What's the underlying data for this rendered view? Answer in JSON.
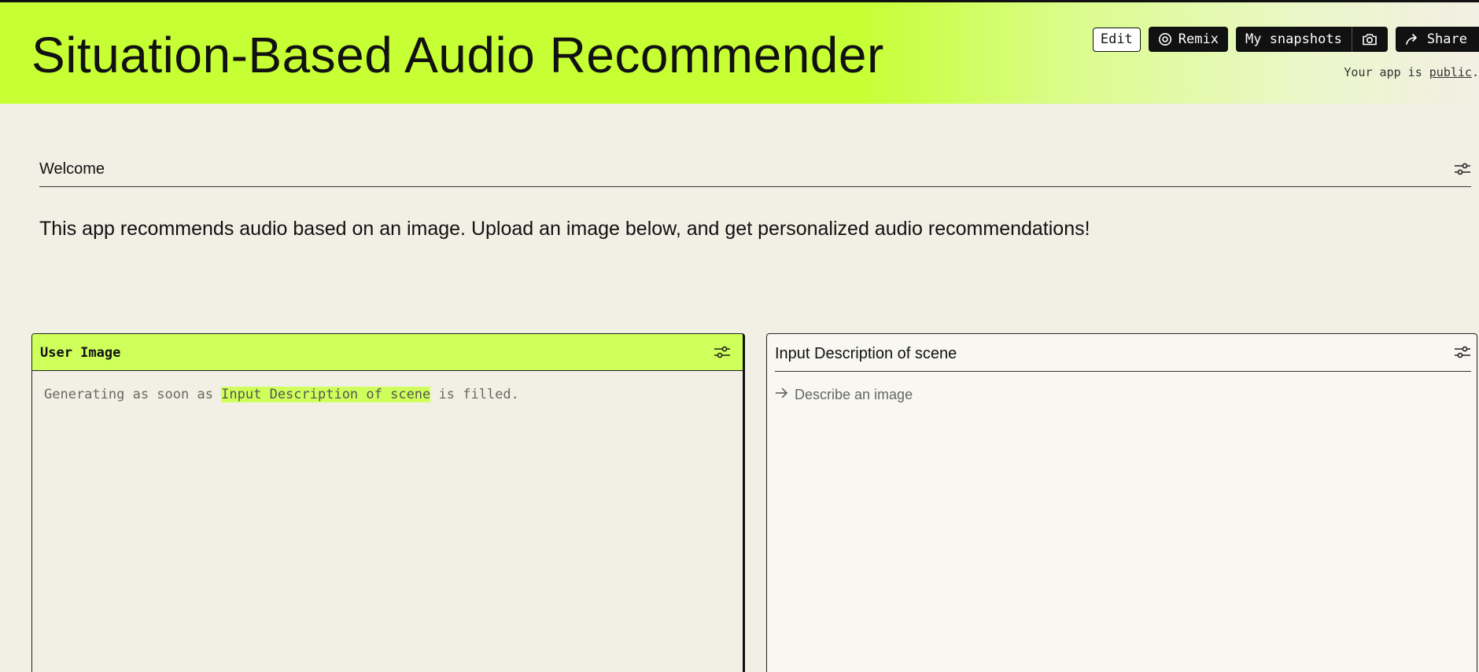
{
  "app": {
    "title": "Situation-Based Audio Recommender"
  },
  "toolbar": {
    "edit_label": "Edit",
    "remix_label": "Remix",
    "snapshots_label": "My snapshots",
    "share_label": "Share"
  },
  "visibility": {
    "prefix": "Your app is ",
    "link": "public",
    "suffix": "."
  },
  "welcome": {
    "label": "Welcome",
    "text": "This app recommends audio based on an image. Upload an image below, and get personalized audio recommendations!"
  },
  "user_image": {
    "title": "User Image",
    "status_prefix": "Generating as soon as ",
    "status_highlight": "Input Description of scene",
    "status_suffix": " is filled."
  },
  "description": {
    "title": "Input Description of scene",
    "placeholder": "Describe an image"
  },
  "icons": {
    "remix": "remix-icon",
    "camera": "camera-icon",
    "share": "share-arrow-icon",
    "settings": "sliders-icon",
    "input_arrow": "arrow-right-icon"
  },
  "colors": {
    "accent": "#c6ff33",
    "panel_header": "#cfff5a",
    "background": "#f2efe4",
    "dark": "#111111"
  }
}
